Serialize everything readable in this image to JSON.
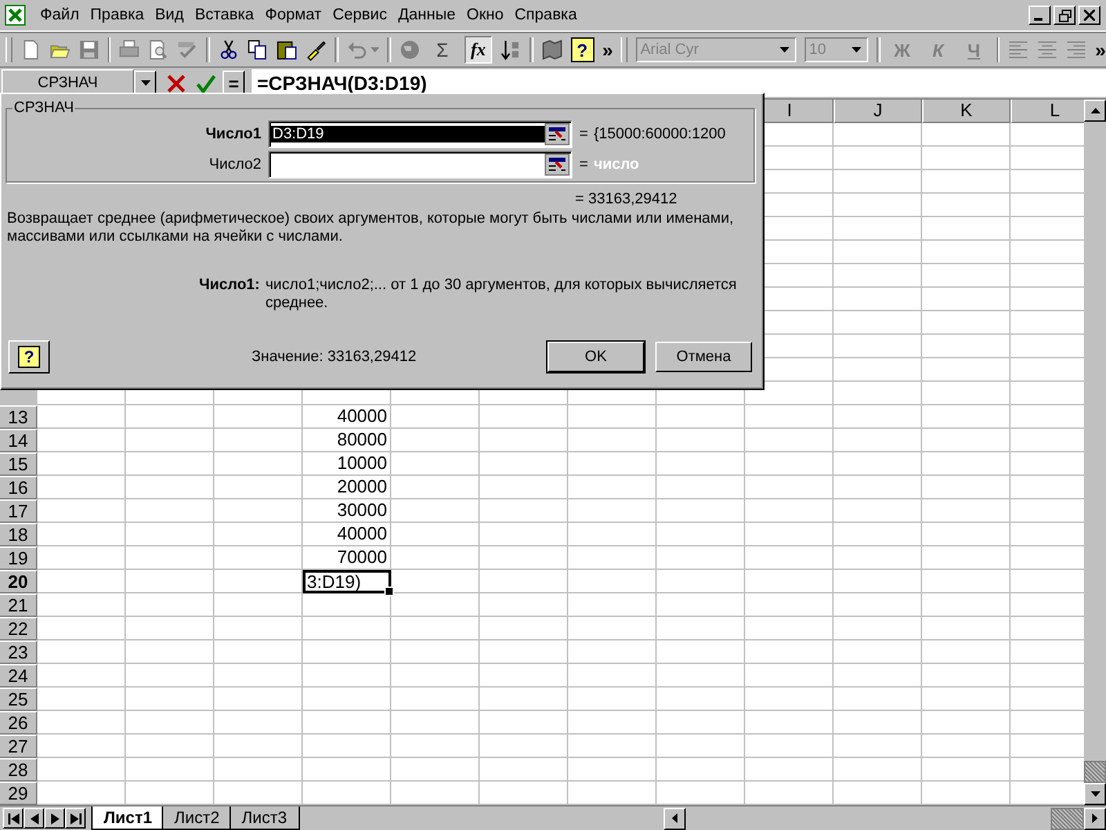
{
  "menu": {
    "items": [
      "Файл",
      "Правка",
      "Вид",
      "Вставка",
      "Формат",
      "Сервис",
      "Данные",
      "Окно",
      "Справка"
    ]
  },
  "toolbar": {
    "sum": "Σ",
    "fx": {
      "label": "fx",
      "on": true
    },
    "help": "?",
    "more": "»",
    "font": {
      "value": "Arial Cyr",
      "disabled": true
    },
    "size": {
      "value": "10",
      "disabled": true
    },
    "format_buttons": [
      "Ж",
      "К",
      "Ч"
    ],
    "more_end": "»"
  },
  "formula_bar": {
    "name_box": "СРЗНАЧ",
    "equals": "=",
    "formula": "=СРЗНАЧ(D3:D19)"
  },
  "dialog": {
    "group_title": "СРЗНАЧ",
    "args": [
      {
        "label": "Число1",
        "value": "D3:D19",
        "selected": true,
        "equals": "=",
        "result": "{15000:60000:1200",
        "kind": "value"
      },
      {
        "label": "Число2",
        "selected": false,
        "equals": "=",
        "result": "число",
        "kind": "type"
      }
    ],
    "total": "= 33163,29412",
    "description": "Возвращает среднее (арифметическое) своих аргументов, которые могут быть числами или именами, массивами или ссылками на ячейки с числами.",
    "arg_help_label": "Число1:",
    "arg_help_text": "число1;число2;... от 1 до 30 аргументов, для которых вычисляется среднее.",
    "help": "?",
    "value_label": "Значение:",
    "value": "33163,29412",
    "buttons": [
      "OK",
      "Отмена"
    ]
  },
  "sheet": {
    "columns": [
      "I",
      "J",
      "K",
      "L"
    ],
    "rows": [
      {
        "header": "13",
        "D": "40000",
        "active": false
      },
      {
        "header": "14",
        "D": "80000",
        "active": false
      },
      {
        "header": "15",
        "D": "10000",
        "active": false
      },
      {
        "header": "16",
        "D": "20000",
        "active": false
      },
      {
        "header": "17",
        "D": "30000",
        "active": false
      },
      {
        "header": "18",
        "D": "40000",
        "active": false
      },
      {
        "header": "19",
        "D": "70000",
        "active": false
      },
      {
        "header": "20",
        "D": "3:D19)",
        "active": true
      },
      {
        "header": "21",
        "active": false
      },
      {
        "header": "22",
        "active": false
      },
      {
        "header": "23",
        "active": false
      },
      {
        "header": "24",
        "active": false
      },
      {
        "header": "25",
        "active": false
      },
      {
        "header": "26",
        "active": false
      },
      {
        "header": "27",
        "active": false
      },
      {
        "header": "28",
        "active": false
      },
      {
        "header": "29",
        "active": false
      }
    ],
    "tabs": [
      {
        "label": "Лист1",
        "selected": true
      },
      {
        "label": "Лист2",
        "selected": false
      },
      {
        "label": "Лист3",
        "selected": false
      }
    ]
  }
}
